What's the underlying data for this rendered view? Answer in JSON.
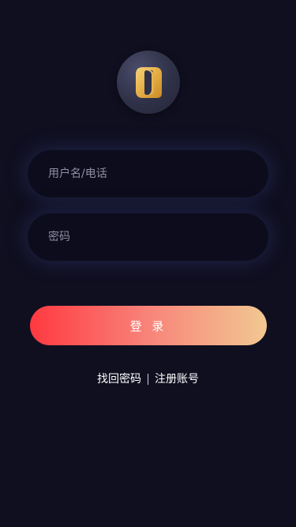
{
  "logo": {
    "name": "app-logo",
    "colors": {
      "circle": "#2f3148",
      "mark": "#e8b64e"
    }
  },
  "form": {
    "username_placeholder": "用户名/电话",
    "password_placeholder": "密码",
    "login_label": "登 录"
  },
  "links": {
    "forgot_password": "找回密码",
    "separator": "|",
    "register": "注册账号"
  },
  "colors": {
    "background": "#100f20",
    "field_background": "#0d0c1c",
    "button_gradient_start": "#ff3940",
    "button_gradient_end": "#f1c891"
  }
}
